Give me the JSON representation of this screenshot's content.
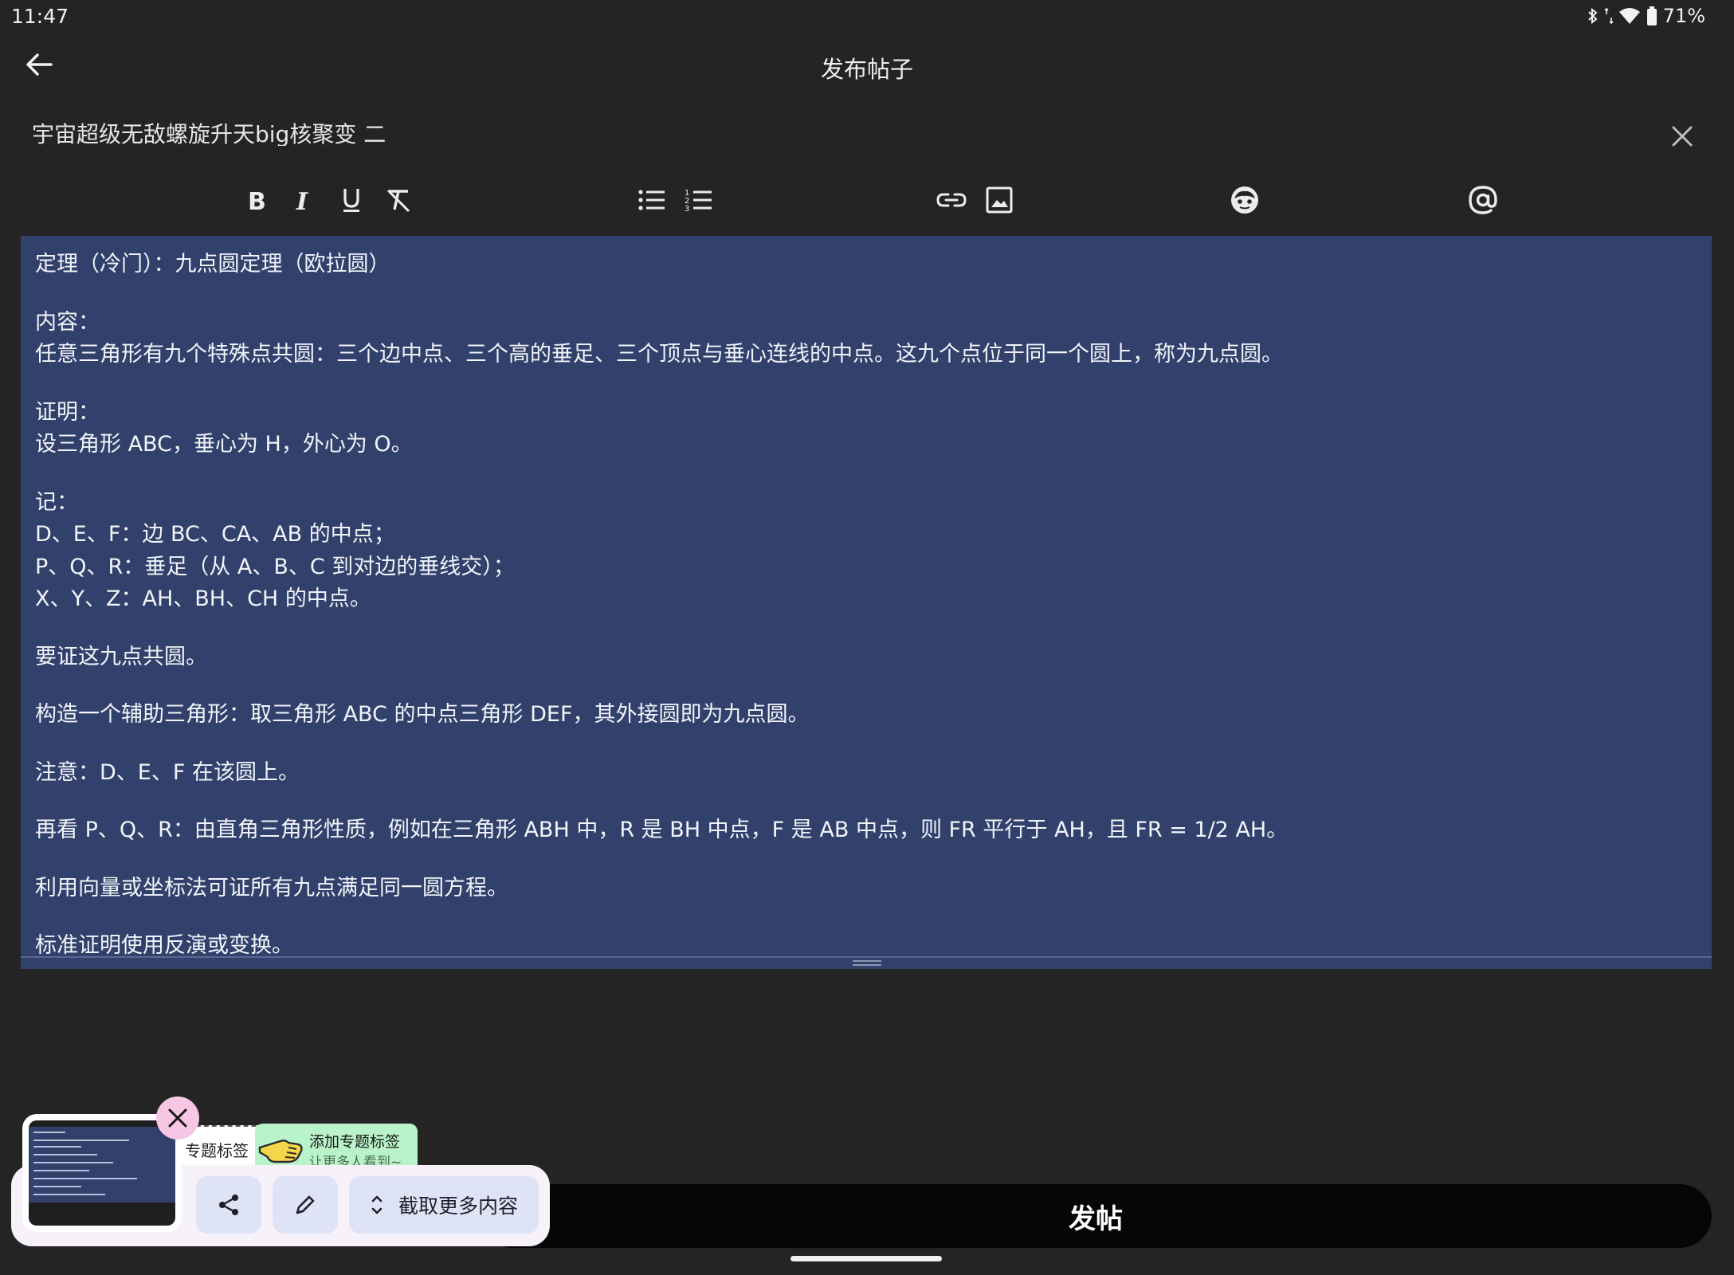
{
  "status_bar": {
    "time": "11:47",
    "battery": "71%"
  },
  "app_bar": {
    "title": "发布帖子"
  },
  "post": {
    "title": "宇宙超级无敌螺旋升天big核聚变 二"
  },
  "toolbar": {
    "icons": [
      "bold-icon",
      "italic-icon",
      "underline-icon",
      "clear-format-icon",
      "bulleted-list-icon",
      "numbered-list-icon",
      "link-icon",
      "image-icon",
      "emoji-icon",
      "mention-icon"
    ]
  },
  "editor": {
    "lines": [
      "定理（冷门）：九点圆定理（欧拉圆）",
      "",
      "内容：",
      "任意三角形有九个特殊点共圆：三个边中点、三个高的垂足、三个顶点与垂心连线的中点。这九个点位于同一个圆上，称为九点圆。",
      "",
      "证明：",
      "设三角形 ABC，垂心为 H，外心为 O。",
      "",
      "记：",
      "D、E、F：边 BC、CA、AB 的中点；",
      "P、Q、R：垂足（从 A、B、C 到对边的垂线交）；",
      "X、Y、Z：AH、BH、CH 的中点。",
      "",
      "要证这九点共圆。",
      "",
      "构造一个辅助三角形：取三角形 ABC 的中点三角形 DEF，其外接圆即为九点圆。",
      "",
      "注意：D、E、F 在该圆上。",
      "",
      "再看 P、Q、R：由直角三角形性质，例如在三角形 ABH 中，R 是 BH 中点，F 是 AB 中点，则 FR 平行于 AH，且 FR = 1/2 AH。",
      "",
      "利用向量或坐标法可证所有九点满足同一圆方程。",
      "",
      "标准证明使用反演或变换。"
    ]
  },
  "tag_banner": {
    "chip_label": "专题标签",
    "hint_title": "添加专题标签",
    "hint_subtitle": "让更多人看到~"
  },
  "screenshot_toolbar": {
    "capture_more_label": "截取更多内容"
  },
  "publish_button": {
    "label": "发帖"
  },
  "colors": {
    "editor_bg": "#31416b",
    "page_bg": "#242424",
    "publish_bg": "#060606",
    "overlay_button_bg": "#dfe3f6",
    "close_bg": "#f6c6e4"
  }
}
